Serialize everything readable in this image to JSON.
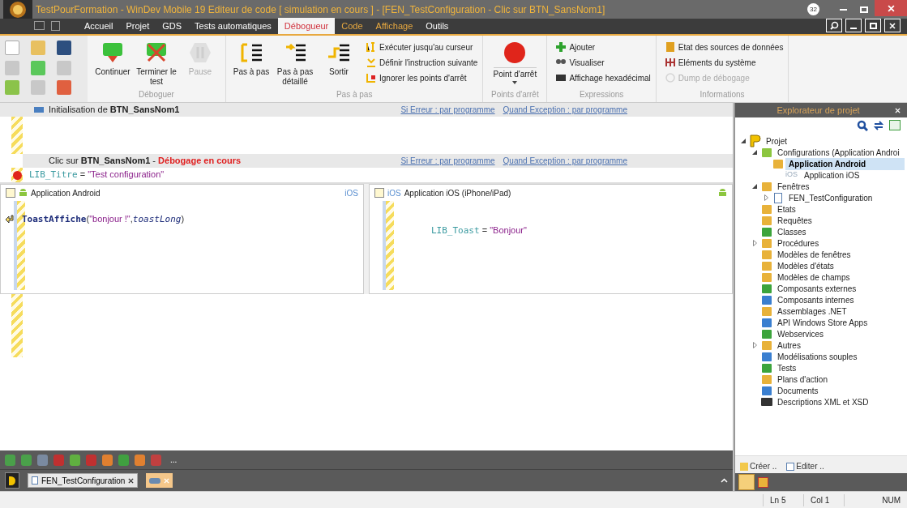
{
  "window": {
    "title": "TestPourFormation - WinDev Mobile 19  Editeur de code [ simulation en cours ] - [FEN_TestConfiguration - Clic sur BTN_SansNom1]",
    "badge": "32"
  },
  "menu_tabs": [
    {
      "label": "Accueil",
      "selected": false,
      "contextual": false
    },
    {
      "label": "Projet",
      "selected": false,
      "contextual": false
    },
    {
      "label": "GDS",
      "selected": false,
      "contextual": false
    },
    {
      "label": "Tests automatiques",
      "selected": false,
      "contextual": false
    },
    {
      "label": "Débogueur",
      "selected": true,
      "contextual": false
    },
    {
      "label": "Code",
      "selected": false,
      "contextual": true
    },
    {
      "label": "Affichage",
      "selected": false,
      "contextual": true
    },
    {
      "label": "Outils",
      "selected": false,
      "contextual": false
    }
  ],
  "ribbon": {
    "groups": [
      {
        "label": "Déboguer",
        "large": [
          {
            "label": "Continuer",
            "disabled": false
          },
          {
            "label": "Terminer le test",
            "disabled": false
          },
          {
            "label": "Pause",
            "disabled": true
          }
        ]
      },
      {
        "label": "Pas à pas",
        "large": [
          {
            "label": "Pas à pas",
            "disabled": false
          },
          {
            "label": "Pas à pas détaillé",
            "disabled": false
          },
          {
            "label": "Sortir",
            "disabled": false
          }
        ],
        "small": [
          {
            "label": "Exécuter jusqu'au curseur",
            "disabled": false
          },
          {
            "label": "Définir l'instruction suivante",
            "disabled": false
          },
          {
            "label": "Ignorer les points d'arrêt",
            "disabled": false
          }
        ]
      },
      {
        "label": "Points d'arrêt",
        "large": [
          {
            "label": "Point d'arrêt",
            "disabled": false
          }
        ]
      },
      {
        "label": "Expressions",
        "small": [
          {
            "label": "Ajouter",
            "disabled": false
          },
          {
            "label": "Visualiser",
            "disabled": false
          },
          {
            "label": "Affichage hexadécimal",
            "disabled": false
          }
        ]
      },
      {
        "label": "Informations",
        "small": [
          {
            "label": "Etat des sources de données",
            "disabled": false
          },
          {
            "label": "Eléments du système",
            "disabled": false
          },
          {
            "label": "Dump de débogage",
            "disabled": true
          }
        ]
      }
    ]
  },
  "editor": {
    "sections": [
      {
        "title": "Initialisation de **BTN_SansNom1**",
        "links": [
          "Si Erreur : par programme",
          "Quand Exception : par programme"
        ]
      },
      {
        "title": "Clic sur **BTN_SansNom1** - ",
        "status": "Débogage en cours",
        "links": [
          "Si Erreur : par programme",
          "Quand Exception : par programme"
        ],
        "lines": [
          {
            "breakpoint": true,
            "current": false,
            "tokens": [
              {
                "kind": "var",
                "text": "LIB_Titre"
              },
              {
                "kind": "op",
                "text": " = "
              },
              {
                "kind": "string",
                "text": "\"Test configuration\""
              }
            ]
          }
        ]
      }
    ],
    "panes": [
      {
        "title": "Application Android",
        "other_label": "iOS",
        "lines": [
          {
            "breakpoint": false,
            "current": true,
            "tokens": [
              {
                "kind": "func",
                "text": "ToastAffiche"
              },
              {
                "kind": "op",
                "text": "("
              },
              {
                "kind": "string",
                "text": "\"bonjour !\""
              },
              {
                "kind": "op",
                "text": ","
              },
              {
                "kind": "const",
                "text": "toastLong"
              },
              {
                "kind": "op",
                "text": ")"
              }
            ]
          }
        ]
      },
      {
        "title": "Application iOS (iPhone/iPad)",
        "title_prefix": "iOS",
        "lines": [
          {
            "breakpoint": false,
            "current": false,
            "tokens": [
              {
                "kind": "var",
                "text": "LIB_Toast"
              },
              {
                "kind": "op",
                "text": " = "
              },
              {
                "kind": "string",
                "text": "\"Bonjour\""
              }
            ]
          }
        ]
      }
    ]
  },
  "bottom_toolbar": {
    "more": "..."
  },
  "document_tabs": [
    {
      "label": "FEN_TestConfiguration",
      "selected": false
    },
    {
      "selected": true
    }
  ],
  "explorer": {
    "title": "Explorateur de projet",
    "tree": [
      {
        "label": "Projet",
        "expanded": true,
        "selected": false,
        "children": [
          {
            "label": "Configurations (Application Androi",
            "expanded": true,
            "selected": false,
            "children": [
              {
                "label": "Application Android",
                "selected": true
              },
              {
                "label": "Application iOS",
                "prefix": "iOS",
                "selected": false
              }
            ]
          },
          {
            "label": "Fenêtres",
            "expanded": true,
            "selected": false,
            "children": [
              {
                "label": "FEN_TestConfiguration",
                "expanded": false,
                "selected": false
              }
            ]
          },
          {
            "label": "Etats",
            "selected": false
          },
          {
            "label": "Requêtes",
            "selected": false
          },
          {
            "label": "Classes",
            "selected": false
          },
          {
            "label": "Procédures",
            "expanded": false,
            "selected": false
          },
          {
            "label": "Modèles de fenêtres",
            "selected": false
          },
          {
            "label": "Modèles d'états",
            "selected": false
          },
          {
            "label": "Modèles de champs",
            "selected": false
          },
          {
            "label": "Composants externes",
            "selected": false
          },
          {
            "label": "Composants internes",
            "selected": false
          },
          {
            "label": "Assemblages .NET",
            "selected": false
          },
          {
            "label": "API Windows Store Apps",
            "selected": false
          },
          {
            "label": "Webservices",
            "selected": false
          },
          {
            "label": "Autres",
            "expanded": false,
            "selected": false
          },
          {
            "label": "Modélisations souples",
            "selected": false
          },
          {
            "label": "Tests",
            "selected": false
          },
          {
            "label": "Plans d'action",
            "selected": false
          },
          {
            "label": "Documents",
            "selected": false
          },
          {
            "label": "Descriptions XML et XSD",
            "selected": false
          }
        ]
      }
    ],
    "actions": [
      "Créer ..",
      "Editer .."
    ]
  },
  "status_bar": [
    "Ln 5",
    "Col 1",
    "NUM"
  ]
}
